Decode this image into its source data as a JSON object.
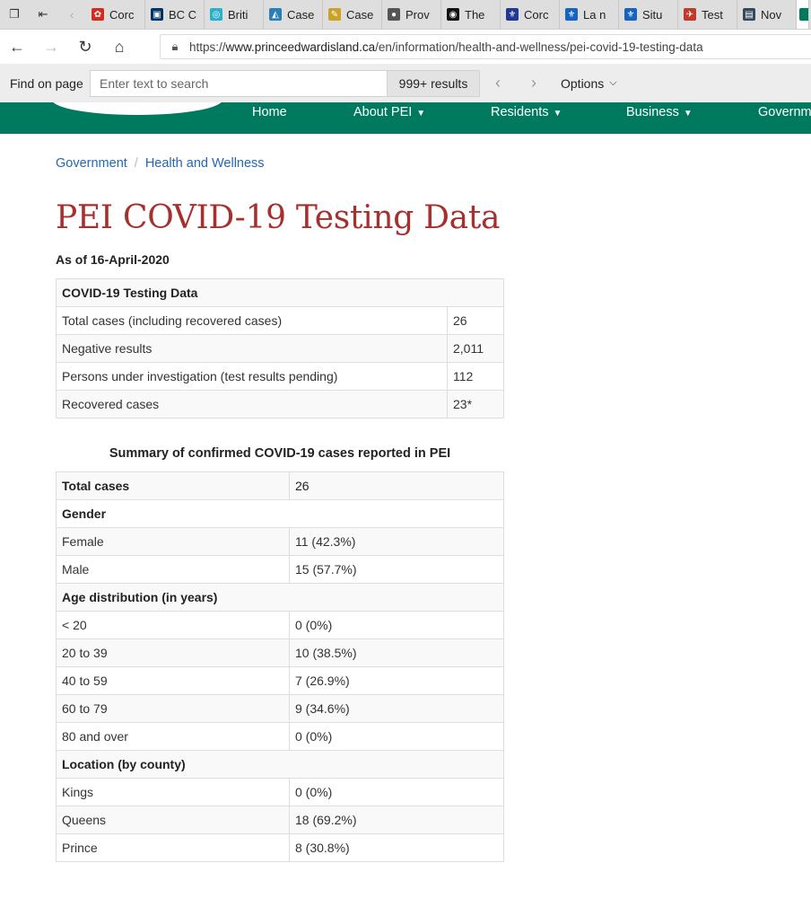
{
  "tabs": [
    {
      "label": "Corc",
      "fav_color": "#d52b1e",
      "fav_glyph": "✿"
    },
    {
      "label": "BC C",
      "fav_color": "#003366",
      "fav_glyph": "▣"
    },
    {
      "label": "Briti",
      "fav_color": "#2ab0c8",
      "fav_glyph": "◎"
    },
    {
      "label": "Case",
      "fav_color": "#2a7fb8",
      "fav_glyph": "◭"
    },
    {
      "label": "Case",
      "fav_color": "#c9a227",
      "fav_glyph": "✎"
    },
    {
      "label": "Prov",
      "fav_color": "#555555",
      "fav_glyph": "●"
    },
    {
      "label": "The",
      "fav_color": "#111111",
      "fav_glyph": "◉"
    },
    {
      "label": "Corc",
      "fav_color": "#1f3a93",
      "fav_glyph": "⚜"
    },
    {
      "label": "La n",
      "fav_color": "#1565c0",
      "fav_glyph": "⚜"
    },
    {
      "label": "Situ",
      "fav_color": "#1565c0",
      "fav_glyph": "⚜"
    },
    {
      "label": "Test",
      "fav_color": "#c0392b",
      "fav_glyph": "✈"
    },
    {
      "label": "Nov",
      "fav_color": "#34495e",
      "fav_glyph": "▤"
    }
  ],
  "address": {
    "prefix": "https://",
    "domain": "www.princeedwardisland.ca",
    "path": "/en/information/health-and-wellness/pei-covid-19-testing-data"
  },
  "find": {
    "label": "Find on page",
    "placeholder": "Enter text to search",
    "results": "999+ results",
    "options": "Options"
  },
  "sitenav": {
    "items": [
      "Home",
      "About PEI",
      "Residents",
      "Business",
      "Governm"
    ]
  },
  "breadcrumb": [
    "Government",
    "Health and Wellness"
  ],
  "page": {
    "title": "PEI COVID-19 Testing Data",
    "as_of": "As of 16-April-2020"
  },
  "testing_table": {
    "header": "COVID-19 Testing Data",
    "rows": [
      {
        "label": "Total cases (including recovered cases)",
        "value": "26"
      },
      {
        "label": "Negative results",
        "value": "2,011"
      },
      {
        "label": "Persons under investigation (test results pending)",
        "value": "112"
      },
      {
        "label": "Recovered cases",
        "value": "23*"
      }
    ]
  },
  "summary": {
    "caption": "Summary of confirmed COVID-19 cases reported in PEI",
    "total_label": "Total cases",
    "total_value": "26",
    "gender_header": "Gender",
    "gender": [
      {
        "label": "Female",
        "value": "11 (42.3%)"
      },
      {
        "label": "Male",
        "value": "15 (57.7%)"
      }
    ],
    "age_header": "Age distribution (in years)",
    "age": [
      {
        "label": "< 20",
        "value": "0 (0%)"
      },
      {
        "label": "20 to 39",
        "value": "10 (38.5%)"
      },
      {
        "label": "40 to 59",
        "value": "7 (26.9%)"
      },
      {
        "label": "60 to 79",
        "value": "9 (34.6%)"
      },
      {
        "label": "80 and over",
        "value": "0 (0%)"
      }
    ],
    "location_header": "Location (by county)",
    "location": [
      {
        "label": "Kings",
        "value": "0 (0%)"
      },
      {
        "label": "Queens",
        "value": "18 (69.2%)"
      },
      {
        "label": "Prince",
        "value": "8 (30.8%)"
      }
    ]
  }
}
